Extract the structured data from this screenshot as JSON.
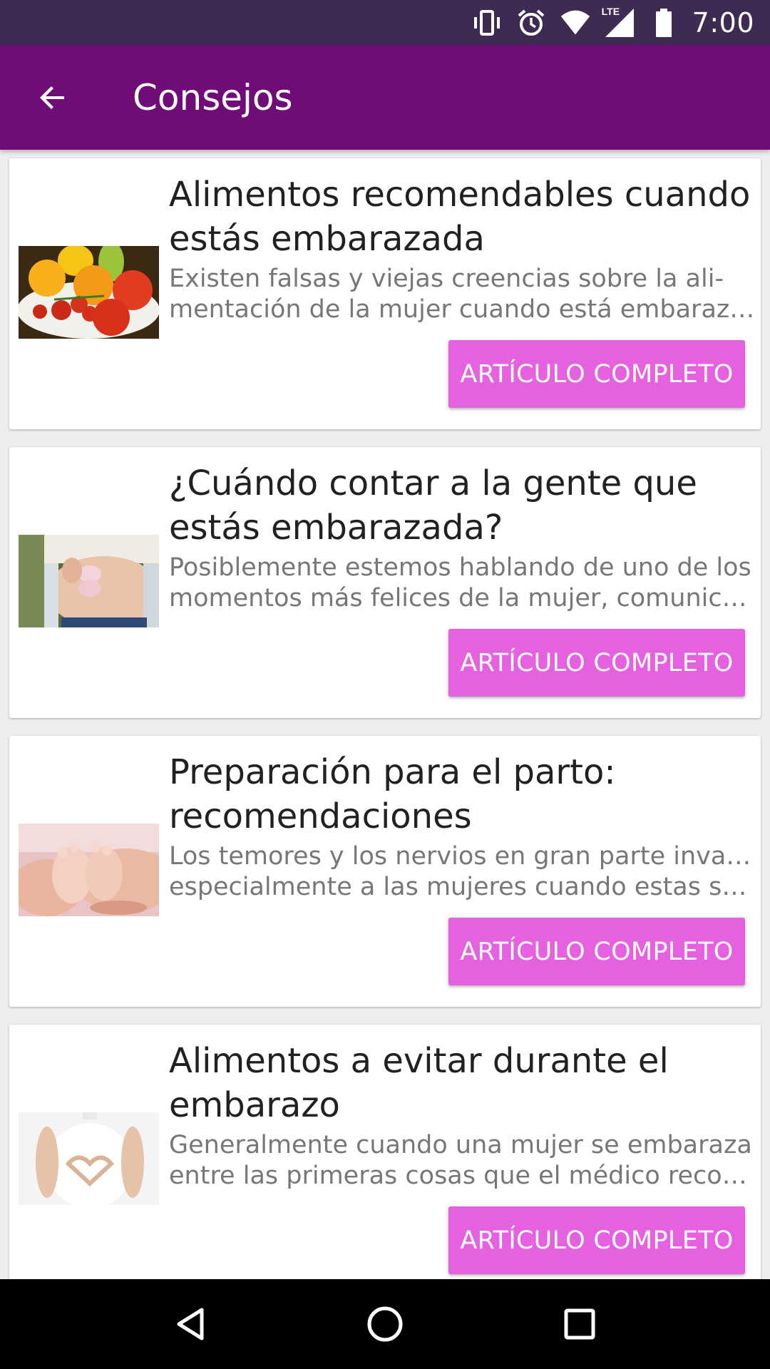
{
  "status_bar": {
    "time": "7:00",
    "icons": [
      "vibrate-icon",
      "alarm-icon",
      "wifi-icon",
      "lte-signal-icon",
      "battery-icon"
    ],
    "lte_label": "LTE"
  },
  "app_bar": {
    "title": "Consejos",
    "back_icon": "arrow-back-icon"
  },
  "articles": [
    {
      "title_line1": "Alimentos recomendables cuando",
      "title_line2": "estás embarazada",
      "snippet_line1": "Existen falsas y viejas creencias sobre la ali-",
      "snippet_line2": "mentación de la mujer cuando está embarazada...",
      "button_label": "ARTÍCULO COMPLETO",
      "image": "fruits-vegetables-photo"
    },
    {
      "title_line1": "¿Cuándo contar a la gente que",
      "title_line2": "estás embarazada?",
      "snippet_line1": "Posiblemente estemos hablando de uno de los",
      "snippet_line2": "momentos más felices de la mujer, comunicarle ...",
      "button_label": "ARTÍCULO COMPLETO",
      "image": "pregnant-belly-photo"
    },
    {
      "title_line1": "Preparación para el parto:",
      "title_line2": "recomendaciones",
      "snippet_line1": "Los temores y los nervios en gran parte invaden",
      "snippet_line2": "especialmente a las mujeres cuando estas son ...",
      "button_label": "ARTÍCULO COMPLETO",
      "image": "baby-feet-photo"
    },
    {
      "title_line1": "Alimentos a evitar durante el",
      "title_line2": "embarazo",
      "snippet_line1": "Generalmente cuando una mujer se embaraza",
      "snippet_line2": "entre las primeras cosas que el médico recomie...",
      "button_label": "ARTÍCULO COMPLETO",
      "image": "heart-hands-belly-photo"
    }
  ],
  "nav_bar": {
    "icons": [
      "back-triangle-icon",
      "home-circle-icon",
      "recents-square-icon"
    ]
  },
  "colors": {
    "status_bar": "#3f2a52",
    "app_bar": "#6f0c77",
    "button": "#e561e0",
    "title_text": "#212121",
    "snippet_text": "#777777"
  }
}
